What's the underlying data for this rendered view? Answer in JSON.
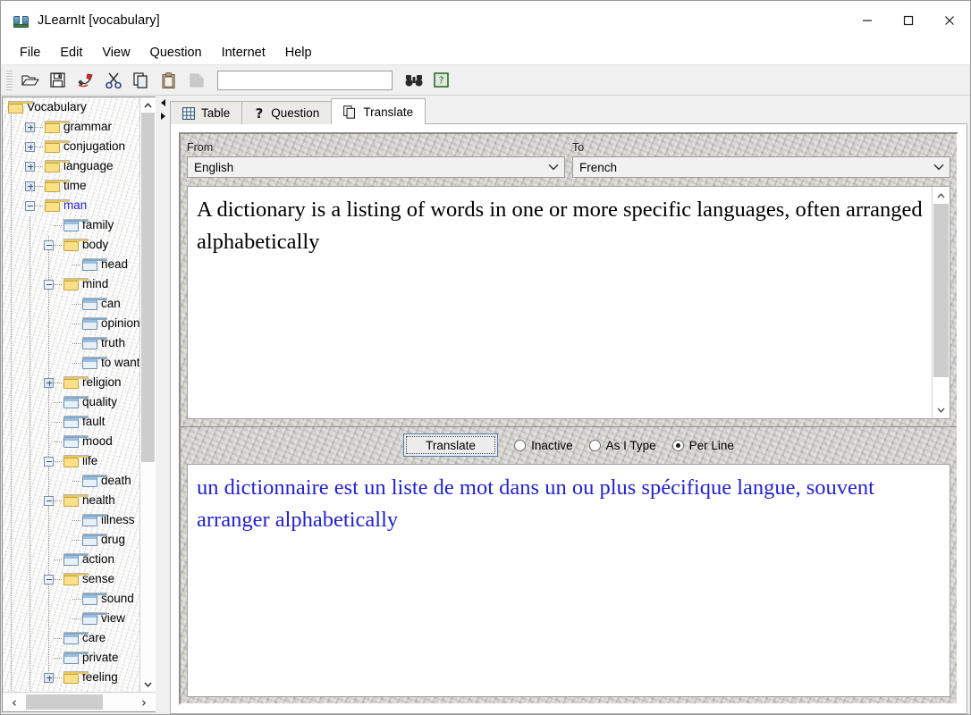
{
  "window": {
    "title": "JLearnIt [vocabulary]",
    "app_icon": "book-icon",
    "minimize_label": "Minimize",
    "maximize_label": "Maximize",
    "close_label": "Close"
  },
  "menu": {
    "items": [
      {
        "label": "File"
      },
      {
        "label": "Edit"
      },
      {
        "label": "View"
      },
      {
        "label": "Question"
      },
      {
        "label": "Internet"
      },
      {
        "label": "Help"
      }
    ]
  },
  "toolbar": {
    "buttons": [
      {
        "name": "open-icon",
        "label": "Open"
      },
      {
        "name": "save-icon",
        "label": "Save"
      },
      {
        "name": "delete-icon",
        "label": "Delete"
      },
      {
        "name": "cut-icon",
        "label": "Cut"
      },
      {
        "name": "copy-icon",
        "label": "Copy"
      },
      {
        "name": "paste-icon",
        "label": "Paste"
      },
      {
        "name": "paste-special-icon",
        "label": "Paste Special"
      }
    ],
    "search_value": "",
    "search_placeholder": "",
    "find_label": "Find",
    "help_label": "Help"
  },
  "tree": {
    "scroll_up_label": "Scroll up",
    "scroll_down_label": "Scroll down",
    "scroll_left_label": "‹",
    "scroll_right_label": "›",
    "nodes": [
      {
        "label": "Vocabulary",
        "depth": 0,
        "folder": "root",
        "expander": "none",
        "selected": false
      },
      {
        "label": "grammar",
        "depth": 1,
        "folder": "closed",
        "expander": "plus",
        "selected": false
      },
      {
        "label": "conjugation",
        "depth": 1,
        "folder": "closed",
        "expander": "plus",
        "selected": false
      },
      {
        "label": "language",
        "depth": 1,
        "folder": "closed",
        "expander": "plus",
        "selected": false
      },
      {
        "label": "time",
        "depth": 1,
        "folder": "closed",
        "expander": "plus",
        "selected": false
      },
      {
        "label": "man",
        "depth": 1,
        "folder": "closed",
        "expander": "minus",
        "selected": true
      },
      {
        "label": "family",
        "depth": 2,
        "folder": "open",
        "expander": "none",
        "selected": false
      },
      {
        "label": "body",
        "depth": 2,
        "folder": "closed",
        "expander": "minus",
        "selected": false
      },
      {
        "label": "head",
        "depth": 3,
        "folder": "open",
        "expander": "none",
        "selected": false
      },
      {
        "label": "mind",
        "depth": 2,
        "folder": "closed",
        "expander": "minus",
        "selected": false
      },
      {
        "label": "can",
        "depth": 3,
        "folder": "open",
        "expander": "none",
        "selected": false
      },
      {
        "label": "opinion",
        "depth": 3,
        "folder": "open",
        "expander": "none",
        "selected": false
      },
      {
        "label": "truth",
        "depth": 3,
        "folder": "open",
        "expander": "none",
        "selected": false
      },
      {
        "label": "to want",
        "depth": 3,
        "folder": "open",
        "expander": "none",
        "selected": false
      },
      {
        "label": "religion",
        "depth": 2,
        "folder": "closed",
        "expander": "plus",
        "selected": false
      },
      {
        "label": "quality",
        "depth": 2,
        "folder": "open",
        "expander": "none",
        "selected": false
      },
      {
        "label": "fault",
        "depth": 2,
        "folder": "open",
        "expander": "none",
        "selected": false
      },
      {
        "label": "mood",
        "depth": 2,
        "folder": "open",
        "expander": "none",
        "selected": false
      },
      {
        "label": "life",
        "depth": 2,
        "folder": "closed",
        "expander": "minus",
        "selected": false
      },
      {
        "label": "death",
        "depth": 3,
        "folder": "open",
        "expander": "none",
        "selected": false
      },
      {
        "label": "health",
        "depth": 2,
        "folder": "closed",
        "expander": "minus",
        "selected": false
      },
      {
        "label": "illness",
        "depth": 3,
        "folder": "open",
        "expander": "none",
        "selected": false
      },
      {
        "label": "drug",
        "depth": 3,
        "folder": "open",
        "expander": "none",
        "selected": false
      },
      {
        "label": "action",
        "depth": 2,
        "folder": "open",
        "expander": "none",
        "selected": false
      },
      {
        "label": "sense",
        "depth": 2,
        "folder": "closed",
        "expander": "minus",
        "selected": false
      },
      {
        "label": "sound",
        "depth": 3,
        "folder": "open",
        "expander": "none",
        "selected": false
      },
      {
        "label": "view",
        "depth": 3,
        "folder": "open",
        "expander": "none",
        "selected": false
      },
      {
        "label": "care",
        "depth": 2,
        "folder": "open",
        "expander": "none",
        "selected": false
      },
      {
        "label": "private",
        "depth": 2,
        "folder": "open",
        "expander": "none",
        "selected": false
      },
      {
        "label": "feeling",
        "depth": 2,
        "folder": "closed",
        "expander": "plus",
        "selected": false
      }
    ]
  },
  "tabs": [
    {
      "label": "Table",
      "icon": "grid-icon",
      "active": false
    },
    {
      "label": "Question",
      "icon": "question-mark-icon",
      "active": false
    },
    {
      "label": "Translate",
      "icon": "pages-icon",
      "active": true
    }
  ],
  "translate": {
    "from_label": "From",
    "to_label": "To",
    "from_value": "English",
    "to_value": "French",
    "source_text": "A dictionary is a listing of words in one or more specific languages, often arranged alphabetically",
    "translate_button": "Translate",
    "modes": [
      {
        "label": "Inactive",
        "selected": false
      },
      {
        "label": "As I Type",
        "selected": false
      },
      {
        "label": "Per Line",
        "selected": true
      }
    ],
    "result_text": "un dictionnaire est un liste de mot dans un ou plus spécifique langue, souvent arranger alphabetically",
    "result_color": "#2222cc",
    "source_color": "#000000",
    "scroll_up_label": "Scroll up",
    "scroll_down_label": "Scroll down"
  }
}
